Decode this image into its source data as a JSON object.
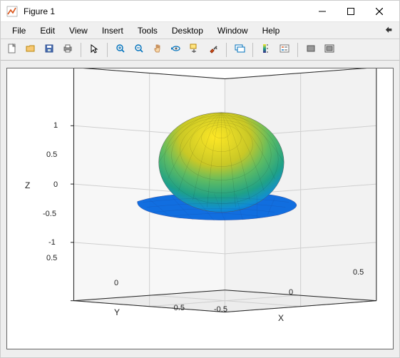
{
  "window": {
    "title": "Figure 1",
    "minimize_tip": "Minimize",
    "maximize_tip": "Maximize",
    "close_tip": "Close"
  },
  "menu": {
    "items": [
      "File",
      "Edit",
      "View",
      "Insert",
      "Tools",
      "Desktop",
      "Window",
      "Help"
    ]
  },
  "toolbar": {
    "new_tip": "New Figure",
    "open_tip": "Open",
    "save_tip": "Save",
    "print_tip": "Print",
    "pointer_tip": "Edit Plot",
    "zoomin_tip": "Zoom In",
    "zoomout_tip": "Zoom Out",
    "pan_tip": "Pan",
    "rotate_tip": "Rotate 3D",
    "cursor_tip": "Data Cursor",
    "brush_tip": "Brush",
    "link_tip": "Link Plot",
    "colorbar_tip": "Insert Colorbar",
    "legend_tip": "Insert Legend",
    "hide_tip": "Hide Plot Tools",
    "show_tip": "Show Plot Tools"
  },
  "chart_data": {
    "type": "surface",
    "view": "3d",
    "x_axis": {
      "label": "X",
      "ticks": [
        -0.5,
        0,
        0.5
      ],
      "range": [
        -0.5,
        0.5
      ]
    },
    "y_axis": {
      "label": "Y",
      "ticks": [
        -0.5,
        0,
        0.5
      ],
      "range": [
        -0.5,
        0.5
      ]
    },
    "z_axis": {
      "label": "Z",
      "ticks": [
        -1,
        -0.5,
        0,
        0.5,
        1
      ],
      "range": [
        -1,
        1
      ]
    },
    "colormap": "parula",
    "surface_description": "Dome-shaped mesh surface centered near origin; z ranges roughly from 0 (blue base) to about 0.9 (yellow top), with a flat flange at the base extending to x/y ≈ ±0.35.",
    "grid": true
  },
  "colors": {
    "accent_blue": "#0072bd",
    "grid": "#bfbfbf",
    "axis": "#222222",
    "parula_low": "#352a87",
    "parula_mid": "#1fa187",
    "parula_high": "#fde725"
  }
}
